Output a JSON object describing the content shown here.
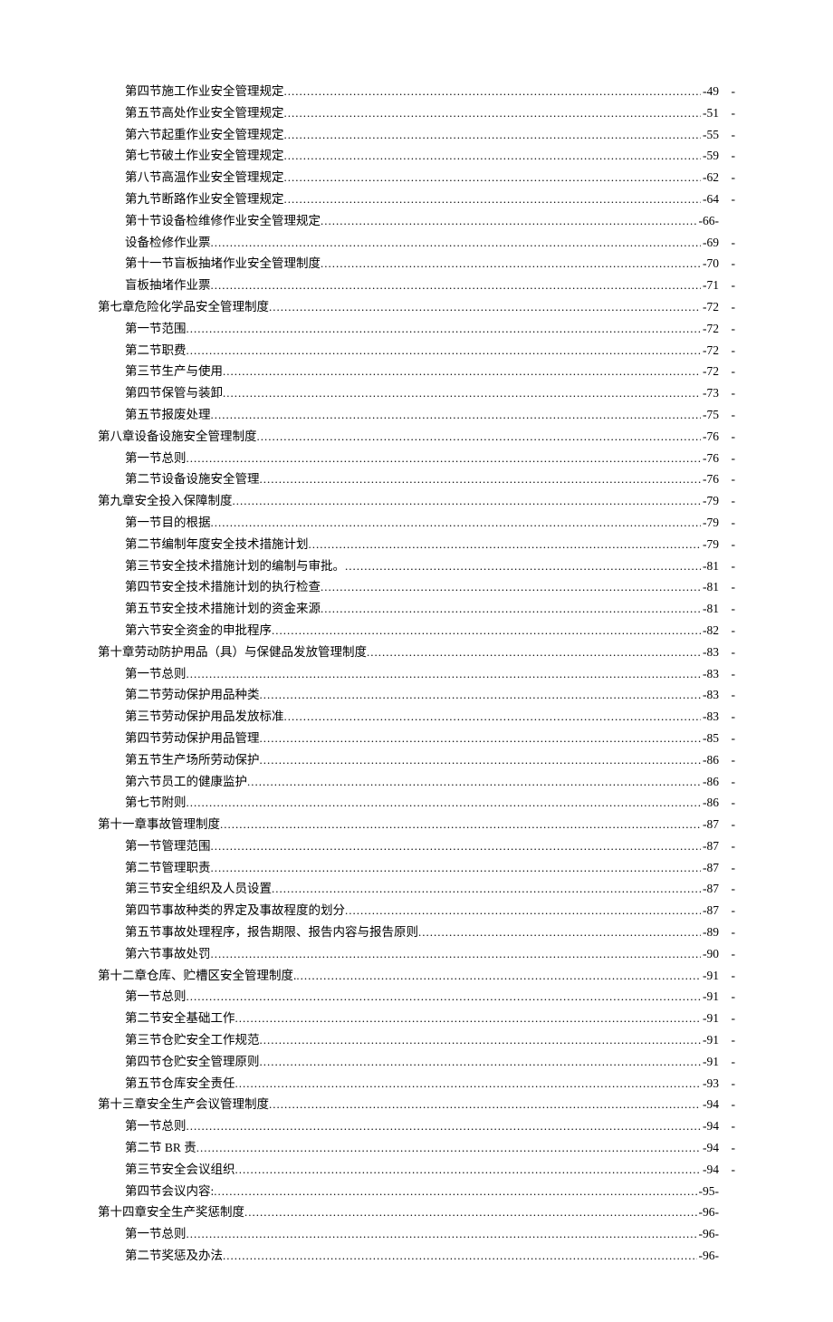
{
  "toc": [
    {
      "indent": 1,
      "title": "第四节施工作业安全管理规定",
      "page": "-49",
      "dash": "-"
    },
    {
      "indent": 1,
      "title": "第五节高处作业安全管理规定",
      "page": "-51",
      "dash": "-"
    },
    {
      "indent": 1,
      "title": "第六节起重作业安全管理规定",
      "page": "-55",
      "dash": "-"
    },
    {
      "indent": 1,
      "title": "第七节破土作业安全管理规定",
      "page": "-59",
      "dash": "-"
    },
    {
      "indent": 1,
      "title": "第八节高温作业安全管理规定",
      "page": "-62",
      "dash": "-"
    },
    {
      "indent": 1,
      "title": "第九节断路作业安全管理规定",
      "page": "-64",
      "dash": "-"
    },
    {
      "indent": 1,
      "title": "第十节设备检维修作业安全管理规定",
      "page": "-66-",
      "dash": ""
    },
    {
      "indent": 1,
      "title": "设备检修作业票",
      "page": "-69",
      "dash": "-"
    },
    {
      "indent": 1,
      "title": "第十一节盲板抽堵作业安全管理制度",
      "page": "-70",
      "dash": "-"
    },
    {
      "indent": 1,
      "title": "盲板抽堵作业票",
      "page": "-71",
      "dash": "-"
    },
    {
      "indent": 0,
      "title": "第七章危险化学品安全管理制度",
      "page": "-72",
      "dash": "-"
    },
    {
      "indent": 1,
      "title": "第一节范围",
      "page": "-72",
      "dash": "-"
    },
    {
      "indent": 1,
      "title": "第二节职费",
      "page": "-72",
      "dash": "-"
    },
    {
      "indent": 1,
      "title": "第三节生产与使用",
      "page": "-72",
      "dash": "-"
    },
    {
      "indent": 1,
      "title": "第四节保管与装卸",
      "page": "-73",
      "dash": "-"
    },
    {
      "indent": 1,
      "title": "第五节报废处理",
      "page": "-75",
      "dash": "-"
    },
    {
      "indent": 0,
      "title": "第八章设备设施安全管理制度",
      "page": "-76",
      "dash": "-"
    },
    {
      "indent": 1,
      "title": "第一节总则",
      "page": "-76",
      "dash": "-"
    },
    {
      "indent": 1,
      "title": "第二节设备设施安全管理",
      "page": "-76",
      "dash": "-"
    },
    {
      "indent": 0,
      "title": "第九章安全投入保障制度",
      "page": "-79",
      "dash": "-"
    },
    {
      "indent": 1,
      "title": "第一节目的根据",
      "page": "-79",
      "dash": "-"
    },
    {
      "indent": 1,
      "title": "第二节编制年度安全技术措施计划",
      "page": "-79",
      "dash": "-"
    },
    {
      "indent": 1,
      "title": "第三节安全技术措施计划的编制与审批。",
      "page": "-81",
      "dash": "-"
    },
    {
      "indent": 1,
      "title": "第四节安全技术措施计划的执行检查",
      "page": "-81",
      "dash": "-"
    },
    {
      "indent": 1,
      "title": "第五节安全技术措施计划的资金来源",
      "page": "-81",
      "dash": "-"
    },
    {
      "indent": 1,
      "title": "第六节安全资金的申批程序",
      "page": "-82",
      "dash": "-"
    },
    {
      "indent": 0,
      "title": "第十章劳动防护用品（具）与保健品发放管理制度",
      "page": "-83",
      "dash": "-"
    },
    {
      "indent": 1,
      "title": "第一节总则",
      "page": "-83",
      "dash": "-"
    },
    {
      "indent": 1,
      "title": "第二节劳动保护用品种类",
      "page": "-83",
      "dash": "-"
    },
    {
      "indent": 1,
      "title": "第三节劳动保护用品发放标准",
      "page": "-83",
      "dash": "-"
    },
    {
      "indent": 1,
      "title": "第四节劳动保护用品管理",
      "page": "-85",
      "dash": "-"
    },
    {
      "indent": 1,
      "title": "第五节生产场所劳动保护",
      "page": "-86",
      "dash": "-"
    },
    {
      "indent": 1,
      "title": "第六节员工的健康监护",
      "page": "-86",
      "dash": "-"
    },
    {
      "indent": 1,
      "title": "第七节附则",
      "page": "-86",
      "dash": "-"
    },
    {
      "indent": 0,
      "title": "第十一章事故管理制度",
      "page": "-87",
      "dash": "-"
    },
    {
      "indent": 1,
      "title": "第一节管理范围",
      "page": "-87",
      "dash": "-"
    },
    {
      "indent": 1,
      "title": "第二节管理职责",
      "page": "-87",
      "dash": "-"
    },
    {
      "indent": 1,
      "title": "第三节安全组织及人员设置",
      "page": "-87",
      "dash": "-"
    },
    {
      "indent": 1,
      "title": "第四节事故种类的界定及事故程度的划分",
      "page": "-87",
      "dash": "-"
    },
    {
      "indent": 1,
      "title": "第五节事故处理程序，报告期限、报告内容与报告原则",
      "page": "-89",
      "dash": "-"
    },
    {
      "indent": 1,
      "title": "第六节事故处罚",
      "page": "-90",
      "dash": "-"
    },
    {
      "indent": 0,
      "title": "第十二章仓库、贮槽区安全管理制度.",
      "page": "-91",
      "dash": "-"
    },
    {
      "indent": 1,
      "title": "第一节总则",
      "page": "-91",
      "dash": "-"
    },
    {
      "indent": 1,
      "title": "第二节安全基础工作",
      "page": "-91",
      "dash": "-"
    },
    {
      "indent": 1,
      "title": "第三节仓贮安全工作规范",
      "page": "-91",
      "dash": "-"
    },
    {
      "indent": 1,
      "title": "第四节仓贮安全管理原则",
      "page": "-91",
      "dash": "-"
    },
    {
      "indent": 1,
      "title": "第五节仓库安全责任",
      "page": "-93",
      "dash": "-"
    },
    {
      "indent": 0,
      "title": "第十三章安全生产会议管理制度",
      "page": "-94",
      "dash": "-"
    },
    {
      "indent": 1,
      "title": "第一节总则",
      "page": "-94",
      "dash": "-"
    },
    {
      "indent": 1,
      "title": "第二节 BR 责",
      "page": "-94",
      "dash": "-"
    },
    {
      "indent": 1,
      "title": "第三节安全会议组织",
      "page": "-94",
      "dash": "-"
    },
    {
      "indent": 1,
      "title": "第四节会议内容:",
      "page": "-95-",
      "dash": ""
    },
    {
      "indent": 0,
      "title": "第十四章安全生产奖惩制度",
      "page": "-96-",
      "dash": ""
    },
    {
      "indent": 1,
      "title": "第一节总则",
      "page": "-96-",
      "dash": ""
    },
    {
      "indent": 1,
      "title": "第二节奖惩及办法",
      "page": "-96-",
      "dash": ""
    }
  ]
}
